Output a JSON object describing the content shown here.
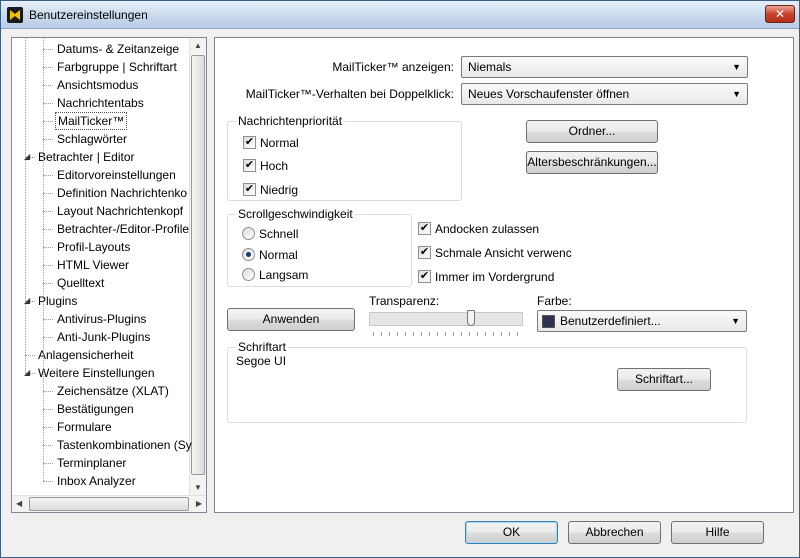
{
  "window": {
    "title": "Benutzereinstellungen",
    "close_label": "✕"
  },
  "tree": {
    "items": [
      {
        "label": "Datums- & Zeitanzeige",
        "level": 2
      },
      {
        "label": "Farbgruppe | Schriftart",
        "level": 2
      },
      {
        "label": "Ansichtsmodus",
        "level": 2
      },
      {
        "label": "Nachrichtentabs",
        "level": 2
      },
      {
        "label": "MailTicker™",
        "level": 2,
        "selected": true
      },
      {
        "label": "Schlagwörter",
        "level": 2
      },
      {
        "label": "Betrachter | Editor",
        "level": 1,
        "expander": "◢"
      },
      {
        "label": "Editorvoreinstellungen",
        "level": 2
      },
      {
        "label": "Definition Nachrichtenko",
        "level": 2
      },
      {
        "label": "Layout Nachrichtenkopf",
        "level": 2
      },
      {
        "label": "Betrachter-/Editor-Profile",
        "level": 2
      },
      {
        "label": "Profil-Layouts",
        "level": 2
      },
      {
        "label": "HTML Viewer",
        "level": 2
      },
      {
        "label": "Quelltext",
        "level": 2
      },
      {
        "label": "Plugins",
        "level": 1,
        "expander": "◢"
      },
      {
        "label": "Antivirus-Plugins",
        "level": 2
      },
      {
        "label": "Anti-Junk-Plugins",
        "level": 2
      },
      {
        "label": "Anlagensicherheit",
        "level": 1
      },
      {
        "label": "Weitere Einstellungen",
        "level": 1,
        "expander": "◢"
      },
      {
        "label": "Zeichensätze (XLAT)",
        "level": 2
      },
      {
        "label": "Bestätigungen",
        "level": 2
      },
      {
        "label": "Formulare",
        "level": 2
      },
      {
        "label": "Tastenkombinationen (Sy",
        "level": 2
      },
      {
        "label": "Terminplaner",
        "level": 2
      },
      {
        "label": "Inbox Analyzer",
        "level": 2
      }
    ]
  },
  "settings": {
    "show_label": "MailTicker™ anzeigen:",
    "show_value": "Niemals",
    "dblclick_label": "MailTicker™-Verhalten bei Doppelklick:",
    "dblclick_value": "Neues Vorschaufenster öffnen",
    "priority_group": "Nachrichtenpriorität",
    "priority": [
      {
        "label": "Normal",
        "checked": true
      },
      {
        "label": "Hoch",
        "checked": true
      },
      {
        "label": "Niedrig",
        "checked": true
      }
    ],
    "folder_button": "Ordner...",
    "age_button": "Altersbeschränkungen...",
    "scroll_group": "Scrollgeschwindigkeit",
    "scroll": [
      {
        "label": "Schnell",
        "checked": false
      },
      {
        "label": "Normal",
        "checked": true
      },
      {
        "label": "Langsam",
        "checked": false
      }
    ],
    "options": [
      {
        "label": "Andocken zulassen",
        "checked": true
      },
      {
        "label": "Schmale Ansicht verwenc",
        "checked": true
      },
      {
        "label": "Immer im Vordergrund",
        "checked": true
      }
    ],
    "apply_button": "Anwenden",
    "transparency_label": "Transparenz:",
    "transparency_level": 0.67,
    "color_label": "Farbe:",
    "color_value": "Benutzerdefiniert...",
    "color_swatch": "#2e3250",
    "font_group": "Schriftart",
    "font_value": "Segoe UI",
    "font_button": "Schriftart..."
  },
  "footer": {
    "ok": "OK",
    "cancel": "Abbrechen",
    "help": "Hilfe"
  },
  "check_glyph": "✔",
  "dropdown_glyph": "▼"
}
